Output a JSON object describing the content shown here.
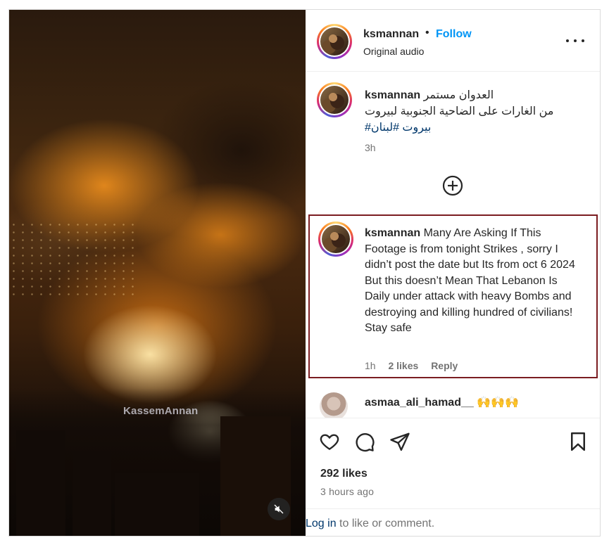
{
  "media": {
    "watermark": "KassemAnnan",
    "mute_icon": "speaker-muted-icon"
  },
  "header": {
    "username": "ksmannan",
    "separator": "•",
    "follow_label": "Follow",
    "audio_label": "Original audio",
    "more_icon": "more-options-icon"
  },
  "caption": {
    "username": "ksmannan",
    "line1": "العدوان مستمر",
    "line2": "من الغارات على الضاحية الجنوبية لبيروت",
    "hashtags": "#بيروت #لبنان",
    "time": "3h"
  },
  "load_more": {
    "icon": "plus-circle-icon"
  },
  "highlighted_comment": {
    "username": "ksmannan",
    "text": "Many Are Asking If This Footage is from tonight Strikes , sorry I didn’t post the date but Its from oct 6 2024",
    "text2": "But this doesn’t Mean That Lebanon Is Daily under attack with heavy Bombs and destroying and killing hundred of civilians! Stay safe",
    "time": "1h",
    "likes": "2 likes",
    "reply": "Reply"
  },
  "second_comment": {
    "username": "asmaa_ali_hamad__",
    "emojis": "🙌🙌🙌"
  },
  "actions": {
    "likes": "292 likes",
    "time_ago": "3 hours ago"
  },
  "login": {
    "link": "Log in",
    "rest": " to like or comment."
  },
  "colors": {
    "accent": "#0095f6",
    "hashtag": "#00376b",
    "highlight_border": "#7b1d21",
    "secondary_text": "#737373"
  }
}
